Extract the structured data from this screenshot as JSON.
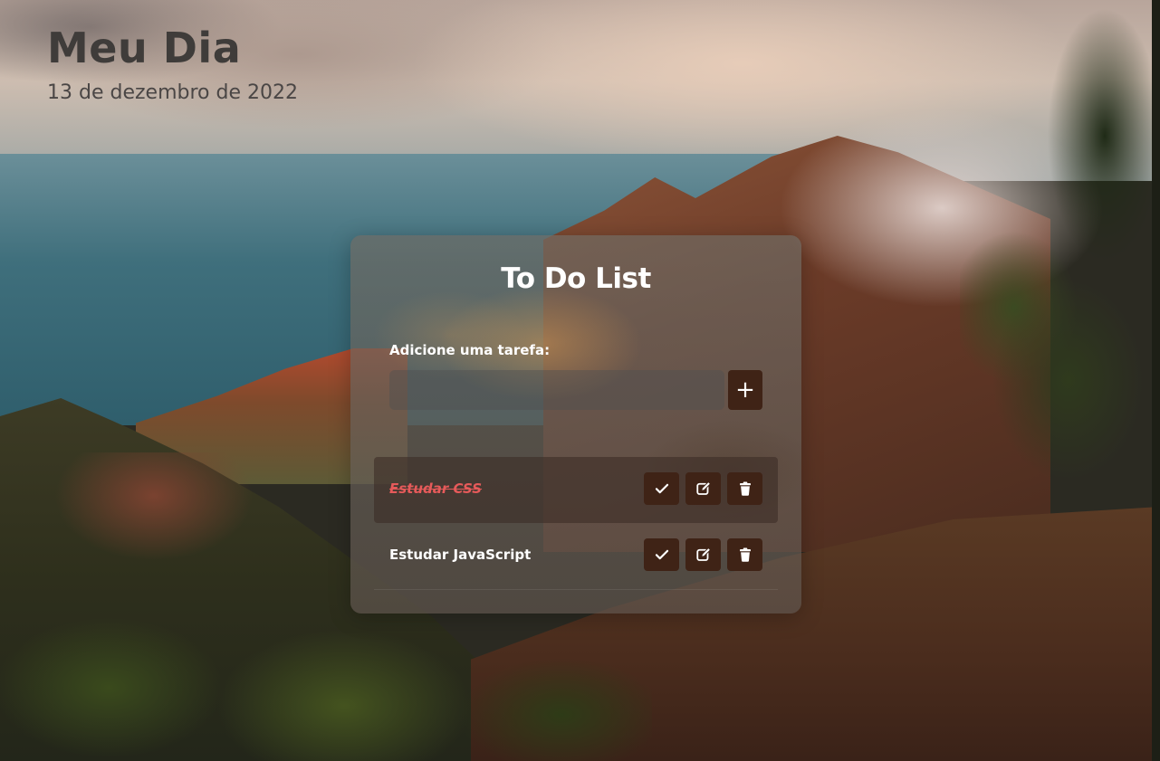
{
  "header": {
    "title": "Meu Dia",
    "date": "13 de dezembro de 2022"
  },
  "card": {
    "title": "To Do List",
    "add_label": "Adicione uma tarefa:",
    "input_value": "",
    "input_placeholder": "",
    "add_button_label": "+",
    "add_button_icon": "plus-icon"
  },
  "todos": [
    {
      "text": "Estudar CSS",
      "done": true
    },
    {
      "text": "Estudar JavaScript",
      "done": false
    }
  ],
  "action_icons": [
    "check-icon",
    "edit-icon",
    "trash-icon"
  ],
  "colors": {
    "button_bg": "#3f2316",
    "done_text": "#e65a5a",
    "title_text": "#3f3c3a",
    "card_text": "#ffffff"
  }
}
